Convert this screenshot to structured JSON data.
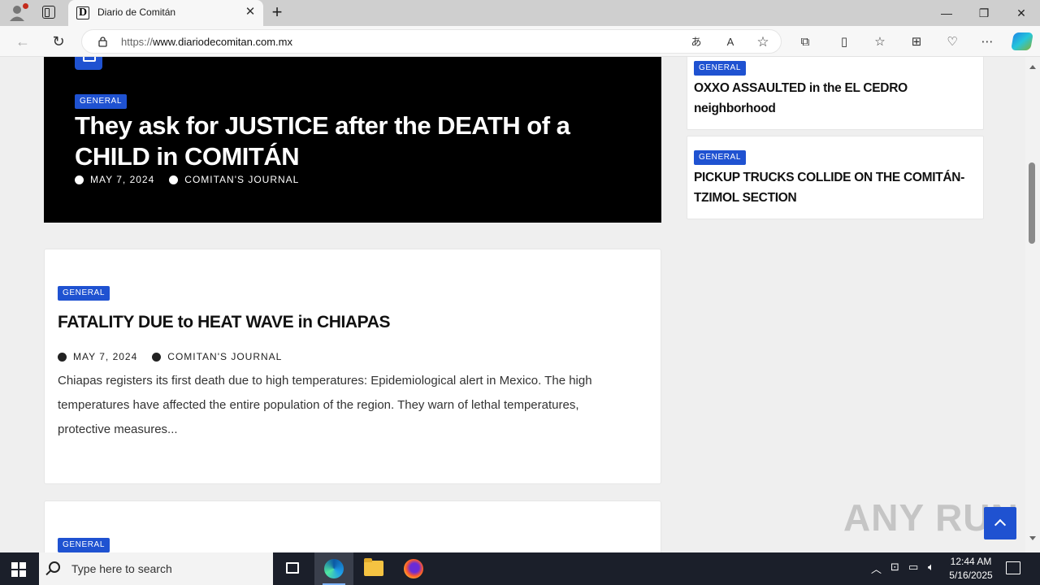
{
  "browser": {
    "tab_title": "Diario de Comitán",
    "favicon_letter": "D",
    "url_prefix": "https://",
    "url_domain": "www.diariodecomitan.com.mx",
    "new_tab_symbol": "+"
  },
  "hero": {
    "category": "GENERAL",
    "title": "They ask for JUSTICE after the DEATH of a CHILD in COMITÁN",
    "date": "MAY 7, 2024",
    "author": "COMITAN'S JOURNAL"
  },
  "main_article": {
    "category": "GENERAL",
    "title": "FATALITY DUE to HEAT WAVE in CHIAPAS",
    "date": "MAY 7, 2024",
    "author": "COMITAN'S JOURNAL",
    "excerpt": "Chiapas registers its first death due to high temperatures: Epidemiological alert in Mexico. The high temperatures have affected the entire population of the region. They warn of lethal temperatures, protective measures..."
  },
  "next_article": {
    "category": "GENERAL"
  },
  "sidebar": {
    "items": [
      {
        "category": "GENERAL",
        "title": "OXXO ASSAULTED in the EL CEDRO neighborhood"
      },
      {
        "category": "GENERAL",
        "title": "PICKUP TRUCKS COLLIDE ON THE COMITÁN-TZIMOL SECTION"
      }
    ]
  },
  "watermark": "ANY RUN",
  "taskbar": {
    "search_placeholder": "Type here to search",
    "time": "12:44 AM",
    "date": "5/16/2025"
  },
  "colors": {
    "accent": "#1f52d1",
    "hero_bg": "#000000",
    "page_bg": "#efefef"
  }
}
